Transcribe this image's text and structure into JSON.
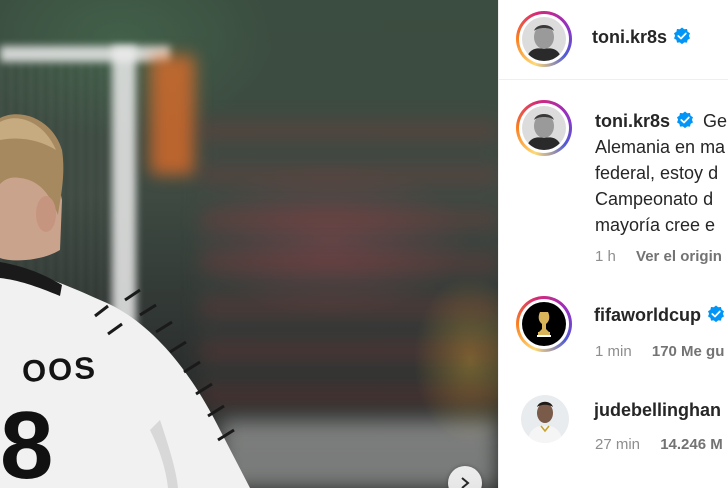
{
  "post": {
    "player_shirt_name": "OOS",
    "player_shirt_number": "8"
  },
  "header": {
    "username": "toni.kr8s"
  },
  "caption": {
    "username": "toni.kr8s",
    "lines": [
      "Ger",
      "Alemania en ma",
      "federal, estoy d",
      "Campeonato d",
      "mayoría cree e"
    ],
    "time": "1 h",
    "translate_label": "Ver el origin"
  },
  "comments": [
    {
      "username": "fifaworldcup",
      "time": "1 min",
      "likes": "170 Me gu"
    },
    {
      "username": "judebellinghan",
      "time": "27 min",
      "likes": "14.246 M"
    }
  ],
  "colors": {
    "verified_blue": "#0095f6",
    "text_primary": "#262626",
    "text_secondary": "#8e8e8e"
  }
}
